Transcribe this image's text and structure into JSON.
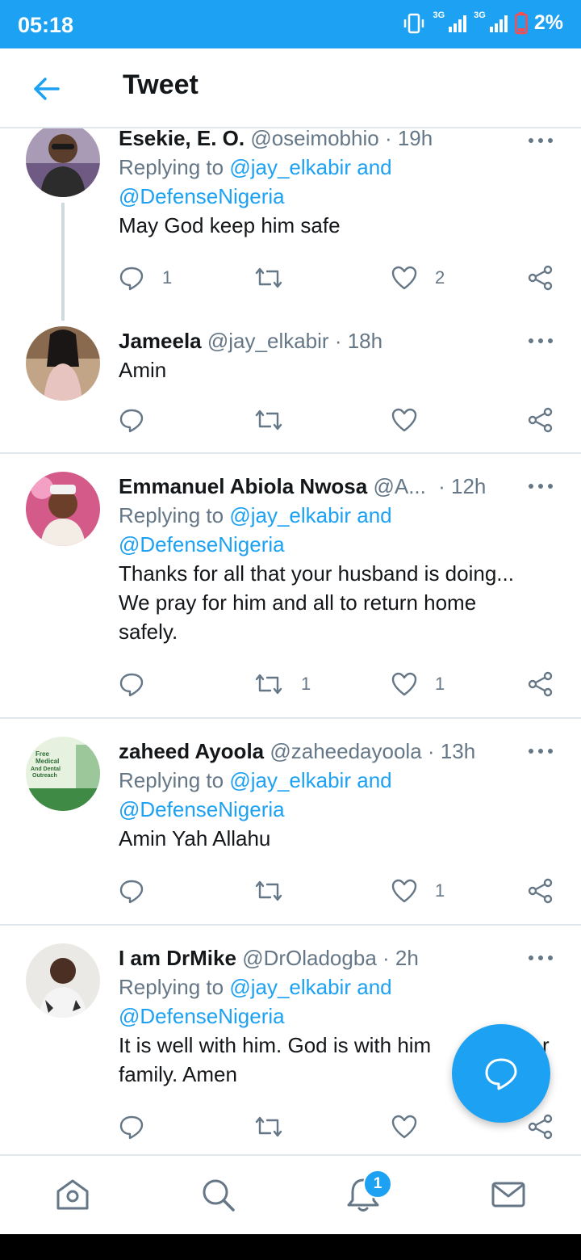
{
  "status": {
    "time": "05:18",
    "network1": "3G",
    "network2": "3G",
    "battery": "2%"
  },
  "header": {
    "title": "Tweet"
  },
  "tweets": [
    {
      "name": "Esekie, E. O.",
      "handle": "@oseimobhio",
      "time": "19h",
      "reply_prefix": "Replying to",
      "reply_user1": "@jay_elkabir",
      "reply_and": "and",
      "reply_user2": "@DefenseNigeria",
      "text": "May God keep him safe",
      "replies": "1",
      "retweets": "",
      "likes": "2"
    },
    {
      "name": "Jameela",
      "handle": "@jay_elkabir",
      "time": "18h",
      "text": "Amin",
      "replies": "",
      "retweets": "",
      "likes": ""
    },
    {
      "name": "Emmanuel Abiola Nwosa",
      "handle": "@A...",
      "time": "12h",
      "reply_prefix": "Replying to",
      "reply_user1": "@jay_elkabir",
      "reply_and": "and",
      "reply_user2": "@DefenseNigeria",
      "text_line1": "Thanks for all that your husband is doing...",
      "text_line2": "We pray for him and all to return home",
      "text_line3": "safely.",
      "replies": "",
      "retweets": "1",
      "likes": "1"
    },
    {
      "name": "zaheed Ayoola",
      "handle": "@zaheedayoola",
      "time": "13h",
      "reply_prefix": "Replying to",
      "reply_user1": "@jay_elkabir",
      "reply_and": "and",
      "reply_user2": "@DefenseNigeria",
      "text": "Amin Yah Allahu",
      "replies": "",
      "retweets": "",
      "likes": "1",
      "avatar_text1": "Free",
      "avatar_text2": "Medical",
      "avatar_text3": "And Dental",
      "avatar_text4": "Outreach"
    },
    {
      "name": "I am DrMike",
      "handle": "@DrOladogba",
      "time": "2h",
      "reply_prefix": "Replying to",
      "reply_user1": "@jay_elkabir",
      "reply_and": "and",
      "reply_user2": "@DefenseNigeria",
      "text_line1": "It is well with him. God is with him",
      "text_line1_tail": "r",
      "text_line2": "family. Amen",
      "replies": "",
      "retweets": "",
      "likes": ""
    }
  ],
  "colors": {
    "accent": "#1da1f2",
    "text": "#14171a",
    "muted": "#657786",
    "divider": "#e1e8ed"
  },
  "bottom_nav": {
    "items": [
      "home-icon",
      "search-icon",
      "notifications-icon",
      "messages-icon"
    ],
    "notifications_badge": "1"
  },
  "fab": {
    "icon": "compose-reply-icon"
  }
}
